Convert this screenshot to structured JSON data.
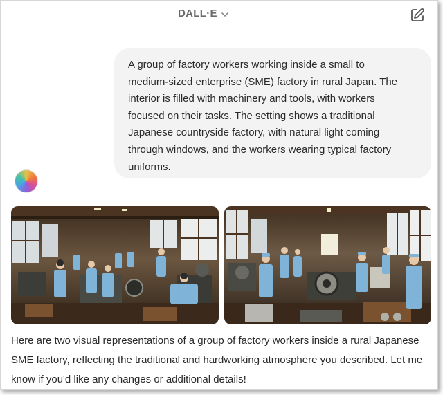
{
  "header": {
    "title": "DALL·E",
    "title_dropdown_icon": "chevron-down-icon",
    "edit_icon": "edit-icon"
  },
  "user_message": {
    "text": "A group of factory workers working inside a small to\nmedium-sized enterprise (SME) factory in rural Japan. The\ninterior is filled with machinery and tools, with workers\nfocused on their tasks. The setting shows a traditional\nJapanese countryside factory, with natural light coming\nthrough windows, and the workers wearing typical factory\nuniforms."
  },
  "assistant": {
    "avatar_icon": "dalle-avatar-icon",
    "images": [
      {
        "kind": "generated-image"
      },
      {
        "kind": "generated-image"
      }
    ],
    "response_text": "Here are two visual representations of a group of factory workers inside a rural Japanese SME factory, reflecting the traditional and hardworking atmosphere you described. Let me know if you'd like any changes or additional details!"
  },
  "colors": {
    "bubble_bg": "#f3f3f3",
    "title": "#6b6b6b",
    "text": "#2a2a2a",
    "uniform_blue": "#7fb3d8",
    "wood": "#6b4a2e"
  }
}
